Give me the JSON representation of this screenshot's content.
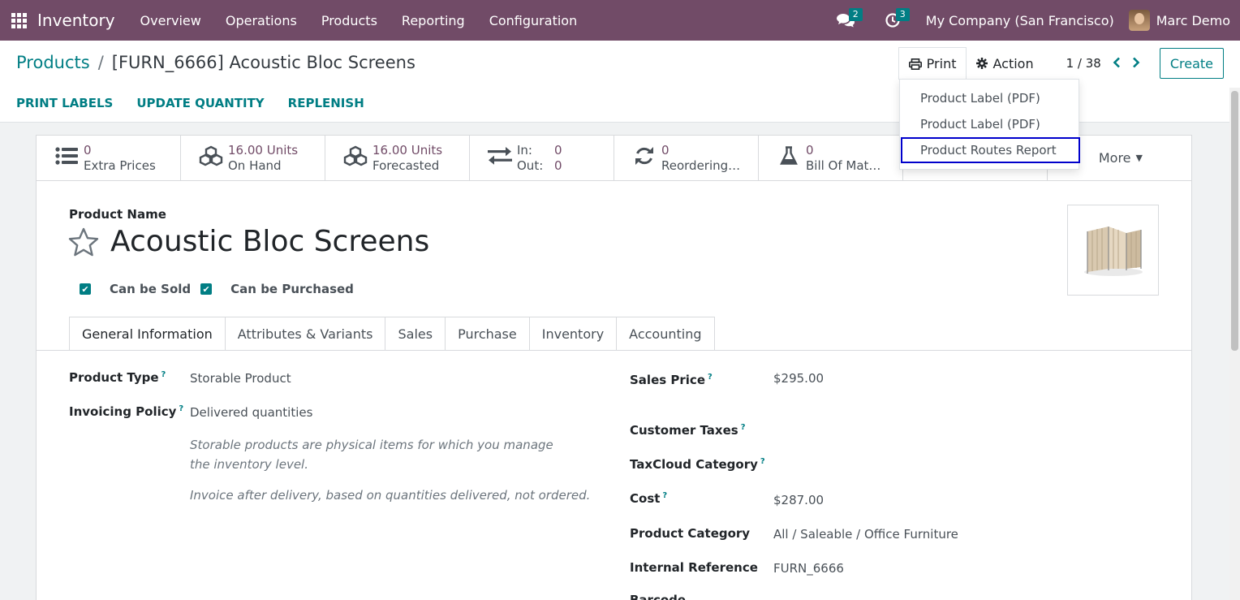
{
  "navbar": {
    "app_name": "Inventory",
    "menu": [
      "Overview",
      "Operations",
      "Products",
      "Reporting",
      "Configuration"
    ],
    "messages_badge": "2",
    "activities_badge": "3",
    "company": "My Company (San Francisco)",
    "user": "Marc Demo"
  },
  "control": {
    "breadcrumb_parent": "Products",
    "breadcrumb_sep": "/",
    "breadcrumb_current": "[FURN_6666] Acoustic Bloc Screens",
    "print_label": "Print",
    "action_label": "Action",
    "pager": "1 / 38",
    "create_label": "Create",
    "status_buttons": [
      "PRINT LABELS",
      "UPDATE QUANTITY",
      "REPLENISH"
    ]
  },
  "print_menu": {
    "items": [
      "Product Label (PDF)",
      "Product Label (PDF)",
      "Product Routes Report"
    ]
  },
  "stats": {
    "extra_prices_value": "0",
    "extra_prices_label": "Extra Prices",
    "on_hand_value": "16.00 Units",
    "on_hand_label": "On Hand",
    "forecasted_value": "16.00 Units",
    "forecasted_label": "Forecasted",
    "in_label": "In:",
    "in_value": "0",
    "out_label": "Out:",
    "out_value": "0",
    "reordering_value": "0",
    "reordering_label": "Reordering…",
    "bom_value": "0",
    "bom_label": "Bill Of Mat…",
    "more_label": "More"
  },
  "product": {
    "name_label": "Product Name",
    "name": "Acoustic Bloc Screens",
    "can_be_sold": "Can be Sold",
    "can_be_purchased": "Can be Purchased"
  },
  "tabs": [
    "General Information",
    "Attributes & Variants",
    "Sales",
    "Purchase",
    "Inventory",
    "Accounting"
  ],
  "general": {
    "product_type_label": "Product Type",
    "product_type": "Storable Product",
    "invoicing_policy_label": "Invoicing Policy",
    "invoicing_policy": "Delivered quantities",
    "help_storable": "Storable products are physical items for which you manage the inventory level.",
    "help_invoice": "Invoice after delivery, based on quantities delivered, not ordered.",
    "sales_price_label": "Sales Price",
    "sales_price": "$295.00",
    "customer_taxes_label": "Customer Taxes",
    "taxcloud_label": "TaxCloud Category",
    "cost_label": "Cost",
    "cost": "$287.00",
    "category_label": "Product Category",
    "category": "All / Saleable / Office Furniture",
    "internal_ref_label": "Internal Reference",
    "internal_ref": "FURN_6666",
    "barcode_label": "Barcode",
    "help_mark": "?"
  }
}
